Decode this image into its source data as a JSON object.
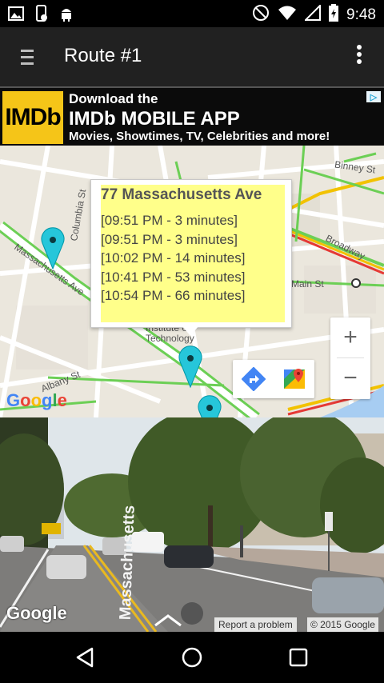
{
  "status_bar": {
    "time": "9:48",
    "icons": [
      "gallery-icon",
      "phone-sync-icon",
      "android-icon",
      "do-not-disturb-icon",
      "wifi-icon",
      "signal-icon",
      "battery-icon"
    ]
  },
  "app_bar": {
    "title": "Route #1",
    "menu_icon": "hamburger-icon",
    "overflow_icon": "more-vert-icon"
  },
  "ad": {
    "logo": "IMDb",
    "line1": "Download the",
    "line2": "IMDb MOBILE APP",
    "line3": "Movies, Showtimes, TV, Celebrities and more!",
    "choice_icon": "adchoices-icon"
  },
  "map": {
    "streets": [
      "Binney St",
      "Columbia St",
      "Massachusetts Ave",
      "Broadway",
      "Main St",
      "Albany St",
      "Institute of Technology"
    ],
    "info_window": {
      "title": "77 Massachusetts Ave",
      "times": [
        "[09:51 PM - 3 minutes]",
        "[09:51 PM - 3 minutes]",
        "[10:02 PM - 14 minutes]",
        "[10:41 PM - 53 minutes]",
        "[10:54 PM - 66 minutes]"
      ]
    },
    "zoom_in": "+",
    "zoom_out": "−",
    "watermark": "Google",
    "pin_color": "#26c6da"
  },
  "street_view": {
    "watermark": "Google",
    "report": "Report a problem",
    "copyright": "© 2015 Google",
    "street_sign": "Massachusetts"
  },
  "nav_bar": {
    "buttons": [
      "back-icon",
      "home-icon",
      "recents-icon"
    ]
  },
  "colors": {
    "app_bar": "#212121",
    "info_bg": "#ffff8a",
    "imdb_yellow": "#f5c518"
  }
}
